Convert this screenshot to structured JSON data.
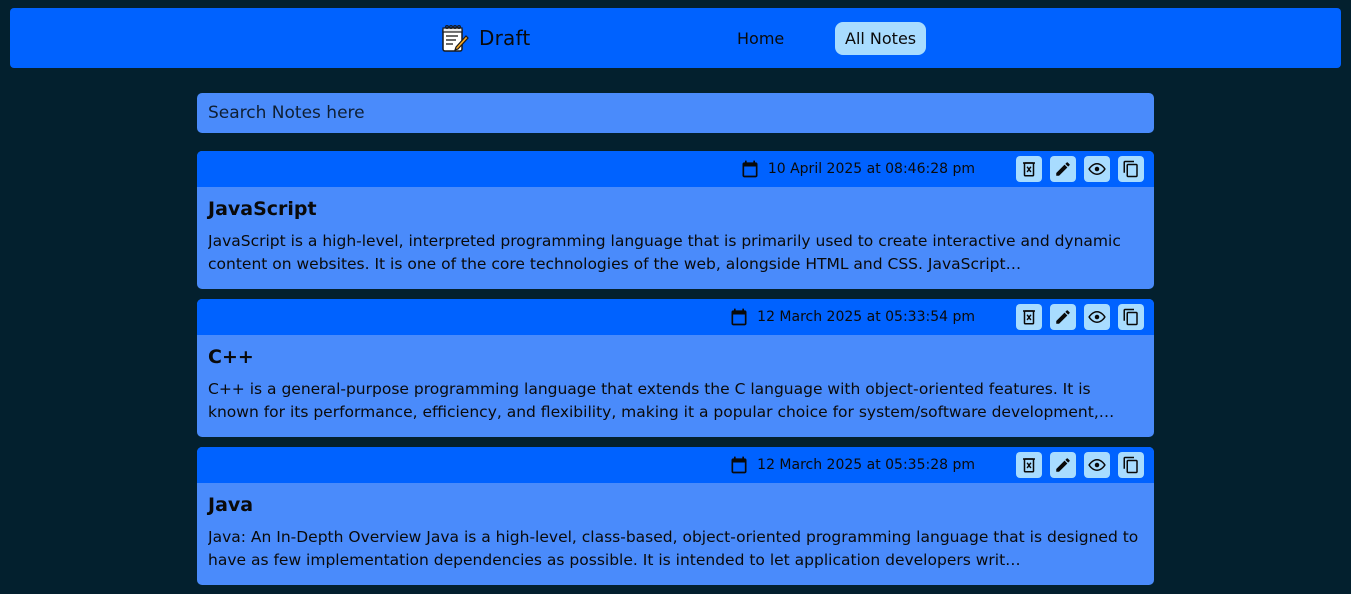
{
  "brand": {
    "name": "Draft",
    "icon": "notepad-pencil-icon"
  },
  "nav": {
    "home": "Home",
    "all_notes": "All Notes"
  },
  "search": {
    "placeholder": "Search Notes here"
  },
  "notes": [
    {
      "date": "10 April 2025 at 08:46:28 pm",
      "title": "JavaScript",
      "content": "JavaScript is a high-level, interpreted programming language that is primarily used to create interactive and dynamic content on websites. It is one of the core technologies of the web, alongside HTML and CSS. JavaScript…"
    },
    {
      "date": "12 March 2025 at 05:33:54 pm",
      "title": "C++",
      "content": "C++ is a general-purpose programming language that extends the C language with object-oriented features. It is known for its performance, efficiency, and flexibility, making it a popular choice for system/software development,…"
    },
    {
      "date": "12 March 2025 at 05:35:28 pm",
      "title": "Java",
      "content": "Java: An In-Depth Overview Java is a high-level, class-based, object-oriented programming language that is designed to have as few implementation dependencies as possible. It is intended to let application developers writ…"
    }
  ],
  "colors": {
    "background": "#03202e",
    "primary": "#0062ff",
    "card": "#4a8bfb",
    "accent": "#a8dcff"
  }
}
